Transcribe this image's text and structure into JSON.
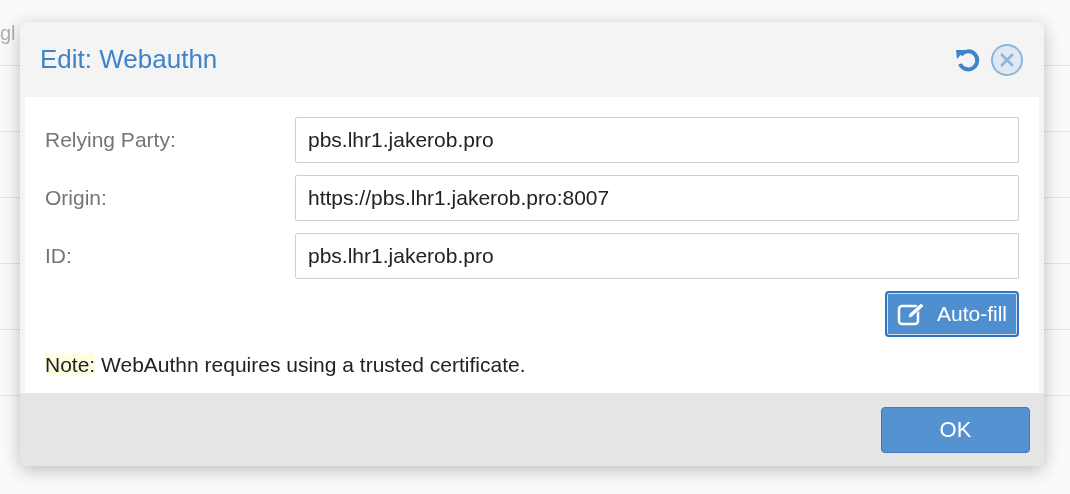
{
  "background": {
    "cell_text": "gl"
  },
  "dialog": {
    "title": "Edit: Webauthn",
    "fields": [
      {
        "label": "Relying Party:",
        "value": "pbs.lhr1.jakerob.pro"
      },
      {
        "label": "Origin:",
        "value": "https://pbs.lhr1.jakerob.pro:8007"
      },
      {
        "label": "ID:",
        "value": "pbs.lhr1.jakerob.pro"
      }
    ],
    "autofill_button": "Auto-fill",
    "note": {
      "label": "Note:",
      "text": "WebAuthn requires using a trusted certificate."
    },
    "ok_button": "OK"
  }
}
